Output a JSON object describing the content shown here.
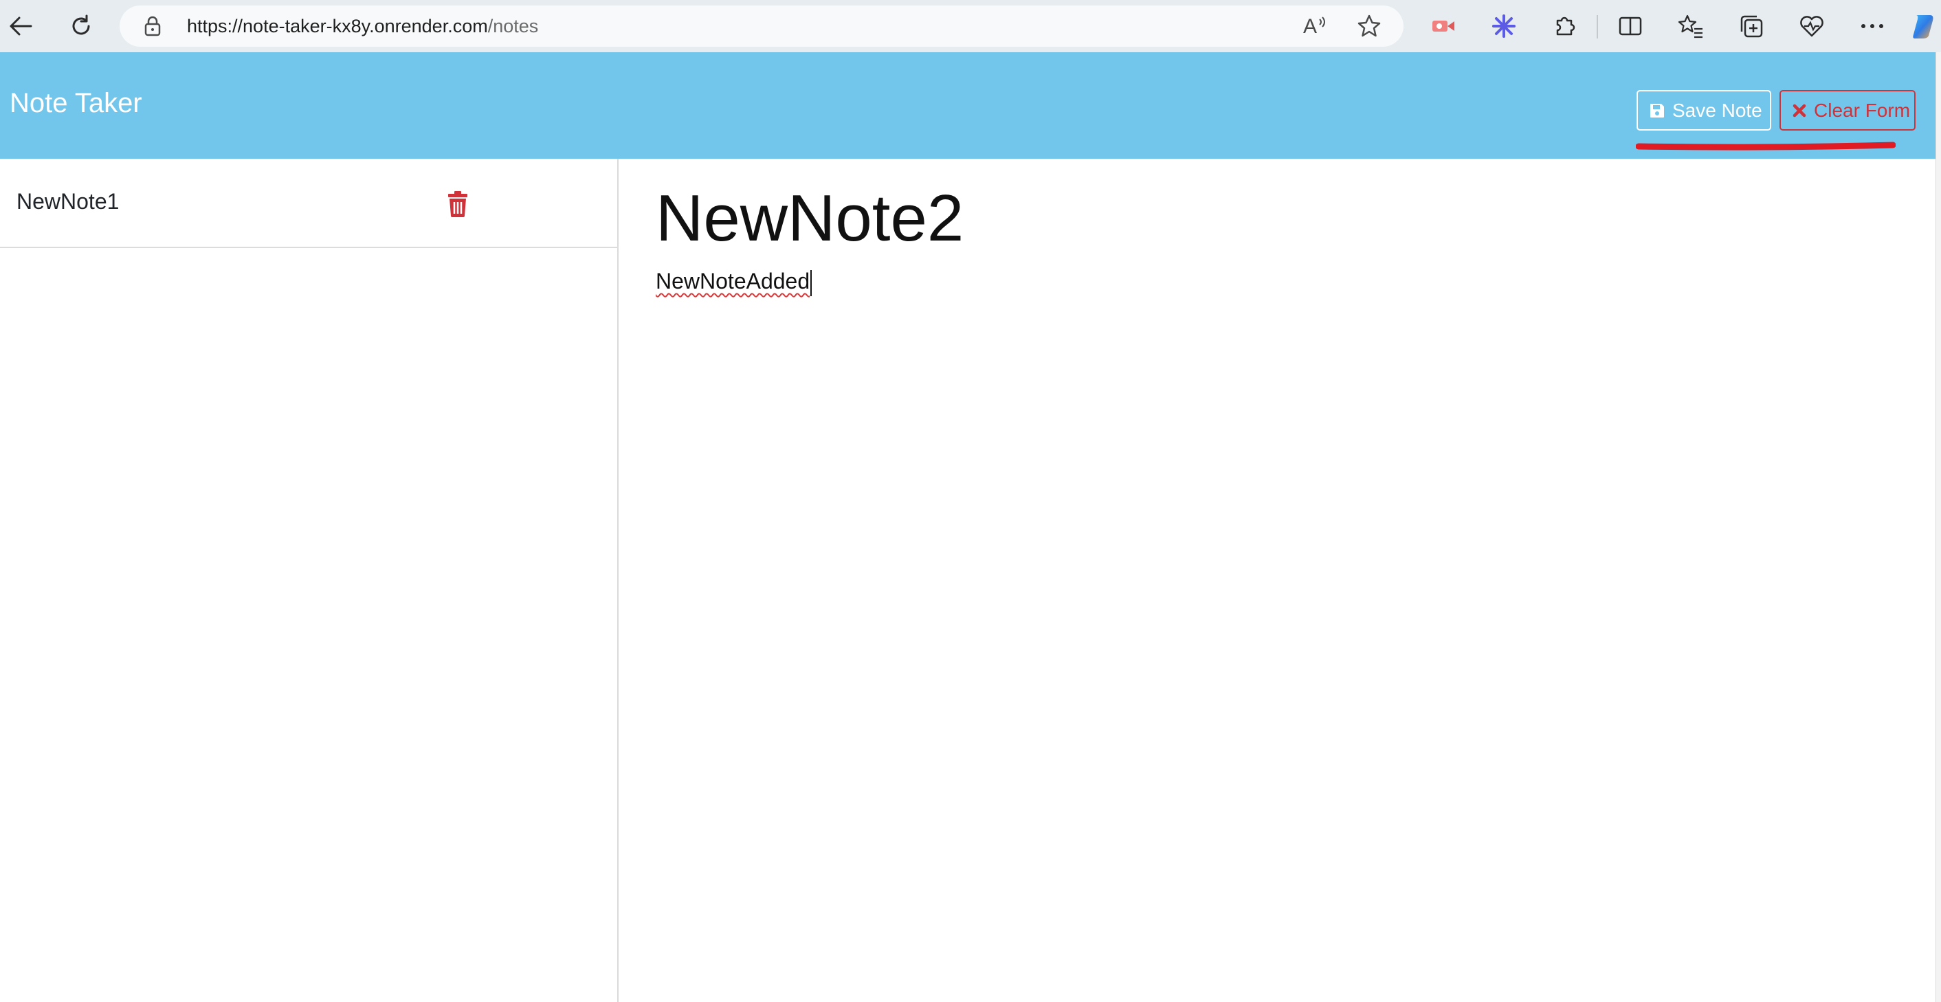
{
  "browser": {
    "url_host": "https://note-taker-kx8y.onrender.com",
    "url_path": "/notes",
    "icons": [
      "back-arrow-icon",
      "refresh-icon",
      "lock-icon",
      "read-aloud-icon",
      "favorite-star-icon",
      "extension-red-icon",
      "extension-asterisk-icon",
      "extensions-puzzle-icon",
      "split-screen-icon",
      "favorites-list-icon",
      "collections-icon",
      "browser-essentials-icon",
      "more-dots-icon",
      "copilot-icon"
    ]
  },
  "header": {
    "title": "Note Taker",
    "save_label": "Save Note",
    "clear_label": "Clear Form"
  },
  "sidebar": {
    "notes": [
      {
        "title": "NewNote1"
      }
    ]
  },
  "editor": {
    "title_value": "NewNote2",
    "body_value": "NewNoteAdded"
  },
  "colors": {
    "header_bg": "#73c6eb",
    "danger": "#d0323a",
    "annotation": "#e01b24"
  }
}
